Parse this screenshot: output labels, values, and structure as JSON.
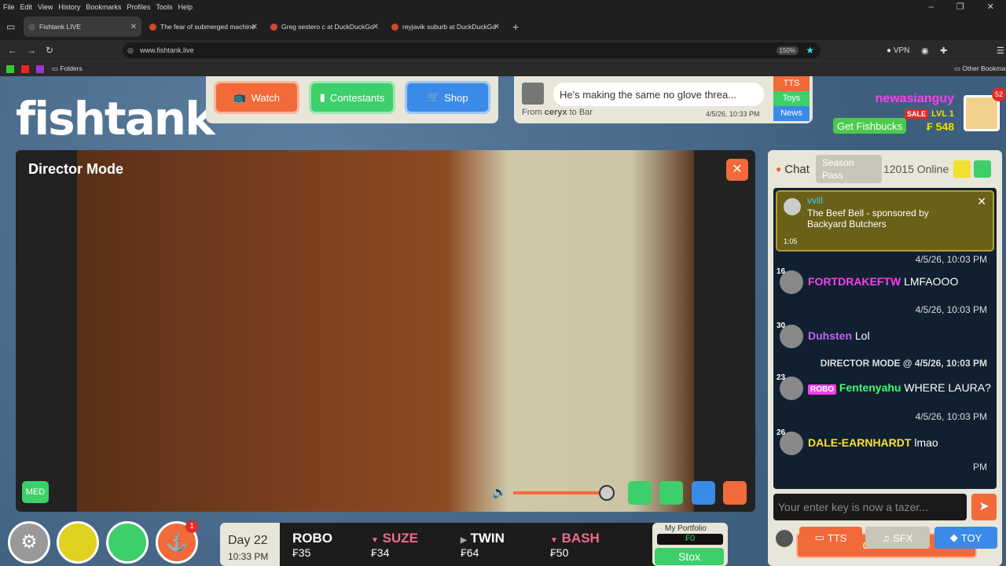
{
  "menu": [
    "File",
    "Edit",
    "View",
    "History",
    "Bookmarks",
    "Profiles",
    "Tools",
    "Help"
  ],
  "tabs": [
    {
      "label": "Fishtank LIVE"
    },
    {
      "label": "The fear of submerged machine"
    },
    {
      "label": "Greg sestero c at DuckDuckGo"
    },
    {
      "label": "reyjavik suburb at DuckDuckGo"
    }
  ],
  "address": {
    "url": "www.fishtank.live",
    "zoom": "150%",
    "vpn": "VPN"
  },
  "bookmarks": {
    "folders": "Folders",
    "other": "Other Bookmarks"
  },
  "logo": {
    "text": "fishtank",
    "mark": "©"
  },
  "nav": {
    "watch": "Watch",
    "contestants": "Contestants",
    "shop": "Shop"
  },
  "notice": {
    "text": "He's making the same no glove threa...",
    "from_label": "From",
    "from_user": "ceryx",
    "to_label": "to",
    "to_user": "Bar",
    "time": "4/5/26, 10:33 PM",
    "tts": "TTS",
    "toys": "Toys",
    "news": "News"
  },
  "user": {
    "name": "newasianguy",
    "sale": "SALE",
    "level": "LVL 1",
    "balance": "₣ 548",
    "get_fishbucks": "Get Fishbucks",
    "notifications": "52"
  },
  "video": {
    "title": "Director Mode",
    "quality": "MED",
    "volume": 0.85
  },
  "ticker": {
    "day": "Day 22",
    "time": "10:33 PM",
    "stocks": [
      {
        "name": "ROBO",
        "price": "₣35",
        "dir": "none"
      },
      {
        "name": "SUZE",
        "price": "₣34",
        "dir": "down"
      },
      {
        "name": "TWIN",
        "price": "₣64",
        "dir": "flat"
      },
      {
        "name": "BASH",
        "price": "₣50",
        "dir": "down"
      }
    ],
    "portfolio_label": "My Portfolio",
    "portfolio_value": "₣0",
    "stox": "Stox"
  },
  "badge": "1",
  "chat": {
    "title": "Chat",
    "season_pass": "Season Pass",
    "online": "12015 Online",
    "pinned": {
      "user": "vvill",
      "text": "The Beef Bell - sponsored by Backyard Butchers",
      "time": "1:05"
    },
    "top_ts": "4/5/26, 10:03 PM",
    "messages": [
      {
        "level": "16",
        "user": "FORTDRAKEFTW",
        "text": "LMFAOOO",
        "ts": "4/5/26, 10:03 PM",
        "color": "#ff3df0"
      },
      {
        "level": "30",
        "user": "Duhsten",
        "text": "Lol",
        "ts": "DIRECTOR MODE @ 4/5/26, 10:03 PM",
        "color": "#c060ff"
      },
      {
        "level": "23",
        "tag": "ROBO",
        "user": "Fentenyahu",
        "text": "WHERE LAURA?",
        "ts": "4/5/26, 10:03 PM",
        "color": "#3dff6a"
      },
      {
        "level": "26",
        "user": "DALE-EARNHARDT",
        "text": "lmao",
        "ts": "PM",
        "color": "#ffe030"
      }
    ],
    "scroll": "Scroll to Bottom",
    "placeholder": "Your enter key is now a tazer...",
    "tts": "TTS",
    "sfx": "SFX",
    "toy": "TOY"
  }
}
